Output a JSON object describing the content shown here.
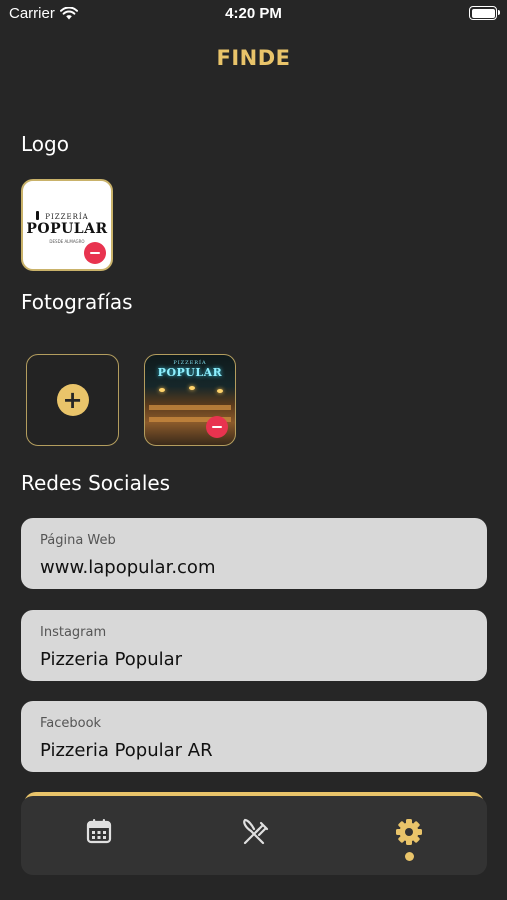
{
  "status_bar": {
    "carrier": "Carrier",
    "time": "4:20 PM"
  },
  "header": {
    "title": "FINDE"
  },
  "logo_section": {
    "title": "Logo",
    "logo_small_text": "PIZZERÍA",
    "logo_big_text": "POPULAR",
    "logo_foot_text": "DESDE ALMAGRO"
  },
  "photos_section": {
    "title": "Fotografías",
    "photo_sign_small": "PIZZERÍA",
    "photo_sign_big": "POPULAR"
  },
  "social_section": {
    "title": "Redes Sociales",
    "fields": [
      {
        "label": "Página Web",
        "value": "www.lapopular.com"
      },
      {
        "label": "Instagram",
        "value": "Pizzeria Popular"
      },
      {
        "label": "Facebook",
        "value": "Pizzeria Popular AR"
      }
    ]
  },
  "tab_bar": {
    "tabs": [
      {
        "icon": "calendar-icon",
        "active": false
      },
      {
        "icon": "utensils-icon",
        "active": false
      },
      {
        "icon": "gear-icon",
        "active": true
      }
    ]
  },
  "colors": {
    "background": "#262626",
    "accent": "#e9c46a",
    "danger": "#e8334f",
    "field_background": "#d8d8d8",
    "tab_bar": "#333333"
  }
}
